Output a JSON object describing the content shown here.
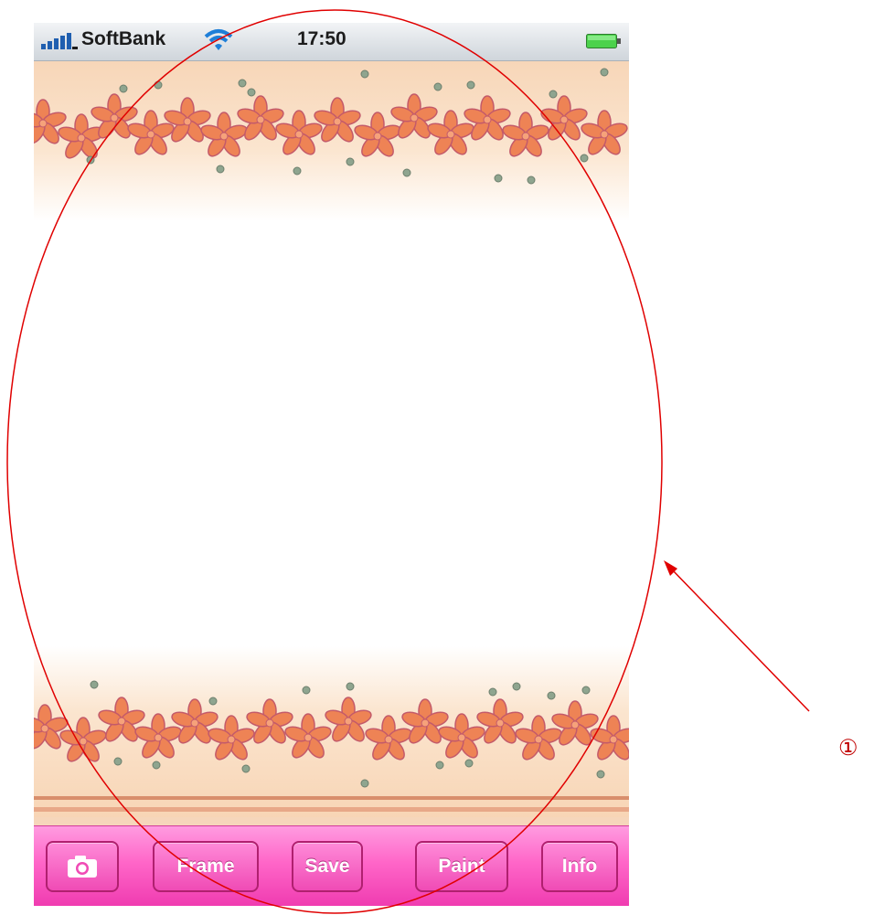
{
  "status_bar": {
    "carrier": "SoftBank",
    "time": "17:50",
    "icons": [
      "signal-bars-icon",
      "wifi-icon",
      "battery-icon"
    ]
  },
  "canvas": {
    "frame_theme": "orange-flower-garland",
    "colors": {
      "band": "#f9dcc0",
      "flower": "#ee8355",
      "flower_outline": "#c35a6a",
      "dot": "#88a28a",
      "stripe": "#d98e6c"
    }
  },
  "toolbar": {
    "camera_icon": "camera-icon",
    "frame_label": "Frame",
    "save_label": "Save",
    "paint_label": "Paint",
    "info_label": "Info",
    "color": "#ff66c8"
  },
  "annotation": {
    "marker": "①",
    "color": "#e00000"
  }
}
